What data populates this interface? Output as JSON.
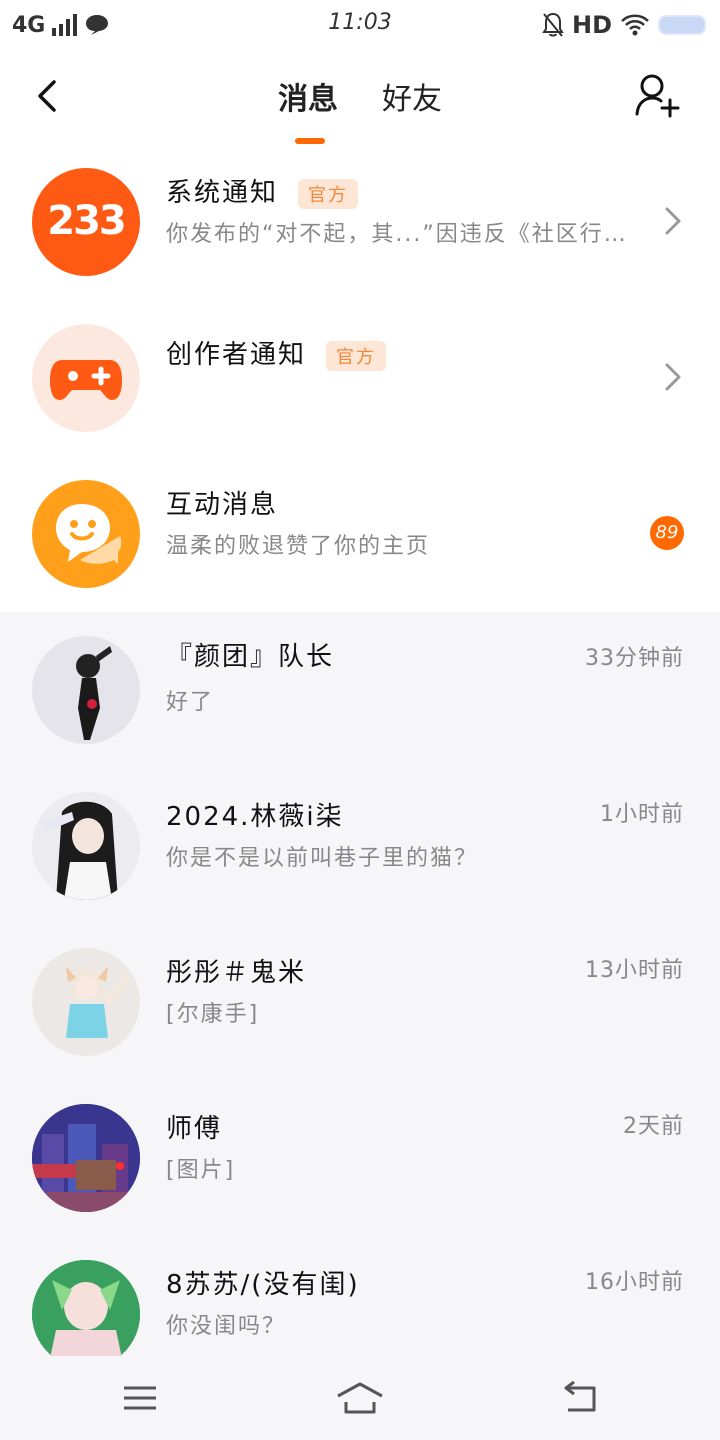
{
  "status_bar": {
    "network": "4G",
    "time": "11:03",
    "hd": "HD"
  },
  "header": {
    "tabs": [
      {
        "label": "消息",
        "active": true
      },
      {
        "label": "好友",
        "active": false
      }
    ]
  },
  "system_rows": [
    {
      "title": "系统通知",
      "badge": "官方",
      "subtitle": "你发布的“对不起，其...”因违反《社区行…",
      "avatar_text": "233",
      "avatar_color": "#ff5a14"
    },
    {
      "title": "创作者通知",
      "badge": "官方",
      "subtitle": "",
      "avatar_icon": "gamepad-plus-icon",
      "avatar_color": "#fde8df"
    },
    {
      "title": "互动消息",
      "subtitle": "温柔的败退赞了你的主页",
      "count": "89",
      "avatar_icon": "chat-bubble-smile-icon",
      "avatar_color": "#ff9f1a"
    }
  ],
  "chats": [
    {
      "name": "『颜团』队长",
      "preview": "好了",
      "time": "33分钟前"
    },
    {
      "name": "2024.林薇i柒",
      "preview": "你是不是以前叫巷子里的猫？",
      "time": "1小时前"
    },
    {
      "name": "彤彤＃鬼米",
      "preview": "[尔康手]",
      "time": "13小时前"
    },
    {
      "name": "师傅",
      "preview": "[图片]",
      "time": "2天前"
    },
    {
      "name": "8苏苏/(没有闺)",
      "preview": "你没闺吗？",
      "time": "16小时前"
    }
  ],
  "colors": {
    "accent": "#ff6a00",
    "official_badge_bg": "#fde6d5",
    "official_badge_text": "#f08a3a"
  }
}
